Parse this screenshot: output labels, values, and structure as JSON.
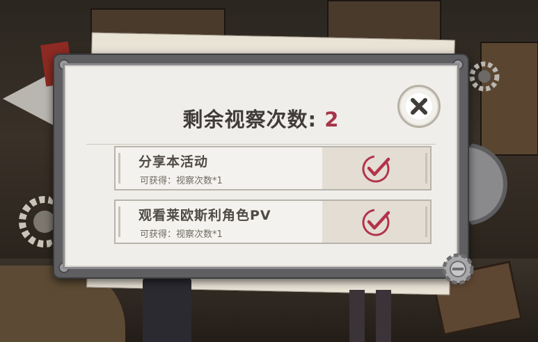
{
  "dialog": {
    "title_label": "剩余视察次数:",
    "title_count": "2"
  },
  "tasks": [
    {
      "title": "分享本活动",
      "reward": "可获得：视察次数*1",
      "status": "completed"
    },
    {
      "title": "观看莱欧斯利角色PV",
      "reward": "可获得：视察次数*1",
      "status": "completed"
    }
  ],
  "icons": {
    "close": "close-x-icon",
    "check": "check-circle-icon",
    "gear": "gear-icon"
  },
  "colors": {
    "count": "#a8344a",
    "check": "#b2344a",
    "panel_bg": "#f0eeea",
    "frame": "#5f5f62"
  }
}
